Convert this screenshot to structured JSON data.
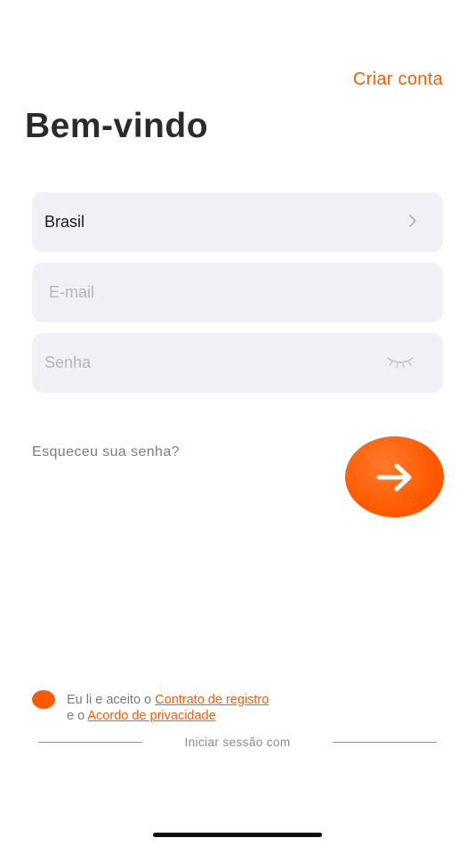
{
  "header": {
    "create_account_label": "Criar conta",
    "title": "Bem-vindo"
  },
  "form": {
    "country": {
      "value": "Brasil",
      "icon": "chevron-right-icon"
    },
    "email": {
      "value": "",
      "placeholder": "E-mail"
    },
    "password": {
      "value": "",
      "placeholder": "Senha",
      "icon": "eye-closed-icon"
    },
    "forgot_password_label": "Esqueceu sua senha?",
    "submit_icon": "arrow-right-icon"
  },
  "agreement": {
    "prefix": "Eu li e aceito o ",
    "contract_link": "Contrato de registro",
    "middle": "e o ",
    "privacy_link": "Acordo de privacidade"
  },
  "footer": {
    "sign_in_with_label": "Iniciar sessão com"
  },
  "colors": {
    "accent": "#ff5a00",
    "field_background": "#f1f0f6",
    "placeholder": "#b6b6bd"
  }
}
